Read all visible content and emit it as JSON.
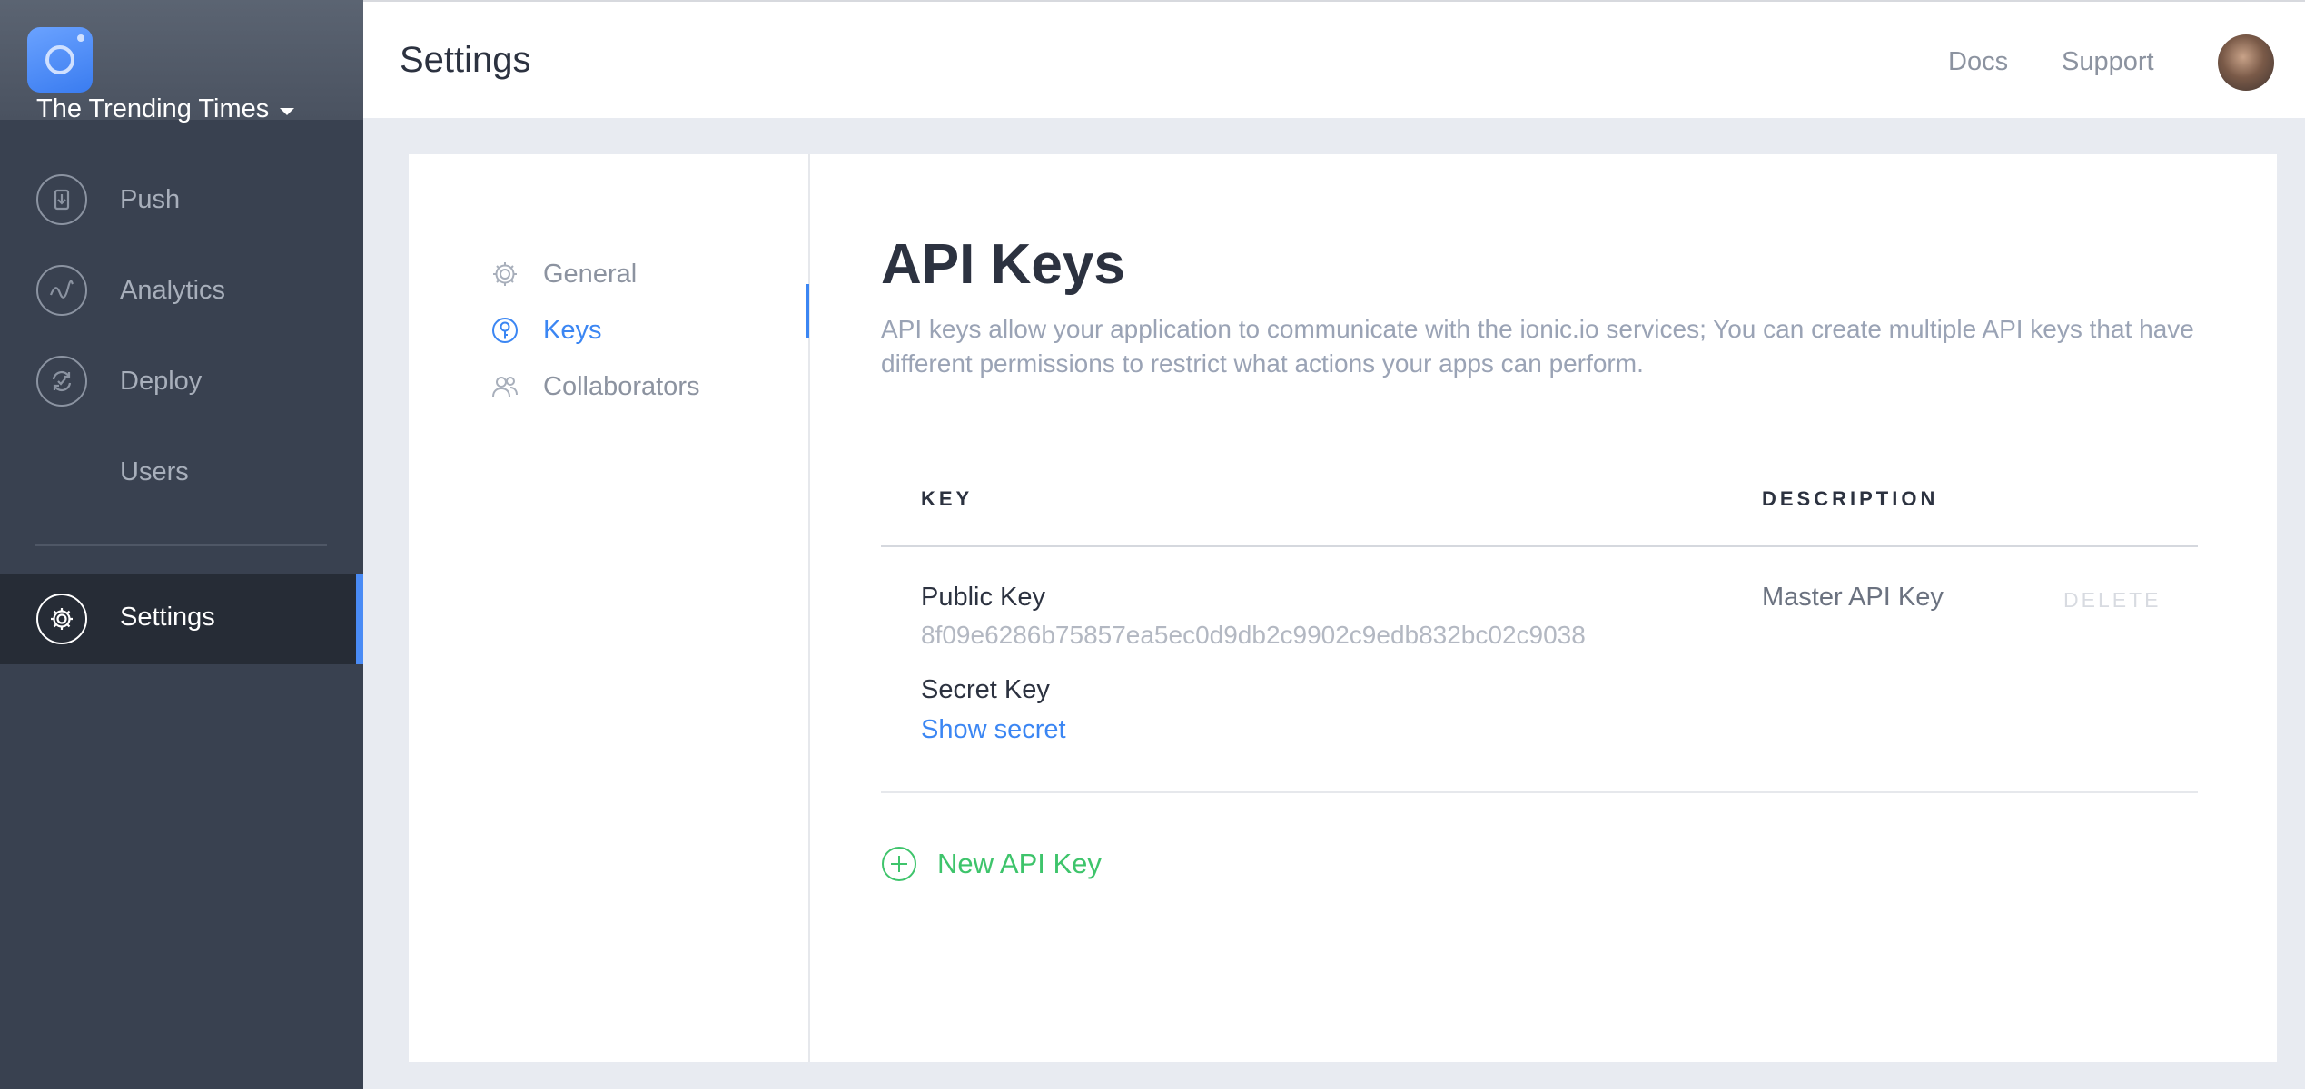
{
  "app": {
    "name": "The Trending Times"
  },
  "sidebar": {
    "items": [
      {
        "label": "Push",
        "icon": "push-icon"
      },
      {
        "label": "Analytics",
        "icon": "analytics-icon"
      },
      {
        "label": "Deploy",
        "icon": "deploy-icon"
      },
      {
        "label": "Users",
        "icon": ""
      },
      {
        "label": "Settings",
        "icon": "gear-icon",
        "active": true
      }
    ]
  },
  "header": {
    "title": "Settings",
    "links": [
      "Docs",
      "Support"
    ]
  },
  "subnav": {
    "items": [
      {
        "label": "General",
        "icon": "gear-icon"
      },
      {
        "label": "Keys",
        "icon": "key-icon",
        "active": true
      },
      {
        "label": "Collaborators",
        "icon": "users-icon"
      }
    ]
  },
  "main": {
    "title": "API Keys",
    "description": "API keys allow your application to communicate with the ionic.io services; You can create multiple API keys that have different permissions to restrict what actions your apps can perform.",
    "table": {
      "headers": [
        "KEY",
        "DESCRIPTION"
      ],
      "rows": [
        {
          "public_label": "Public Key",
          "public_value": "8f09e6286b75857ea5ec0d9db2c9902c9edb832bc02c9038",
          "secret_label": "Secret Key",
          "secret_action": "Show secret",
          "description": "Master API Key",
          "delete_label": "DELETE"
        }
      ]
    },
    "new_key_label": "New API Key"
  },
  "colors": {
    "accent": "#3b86f3",
    "success": "#3ec46b",
    "sidebar": "#394150"
  }
}
